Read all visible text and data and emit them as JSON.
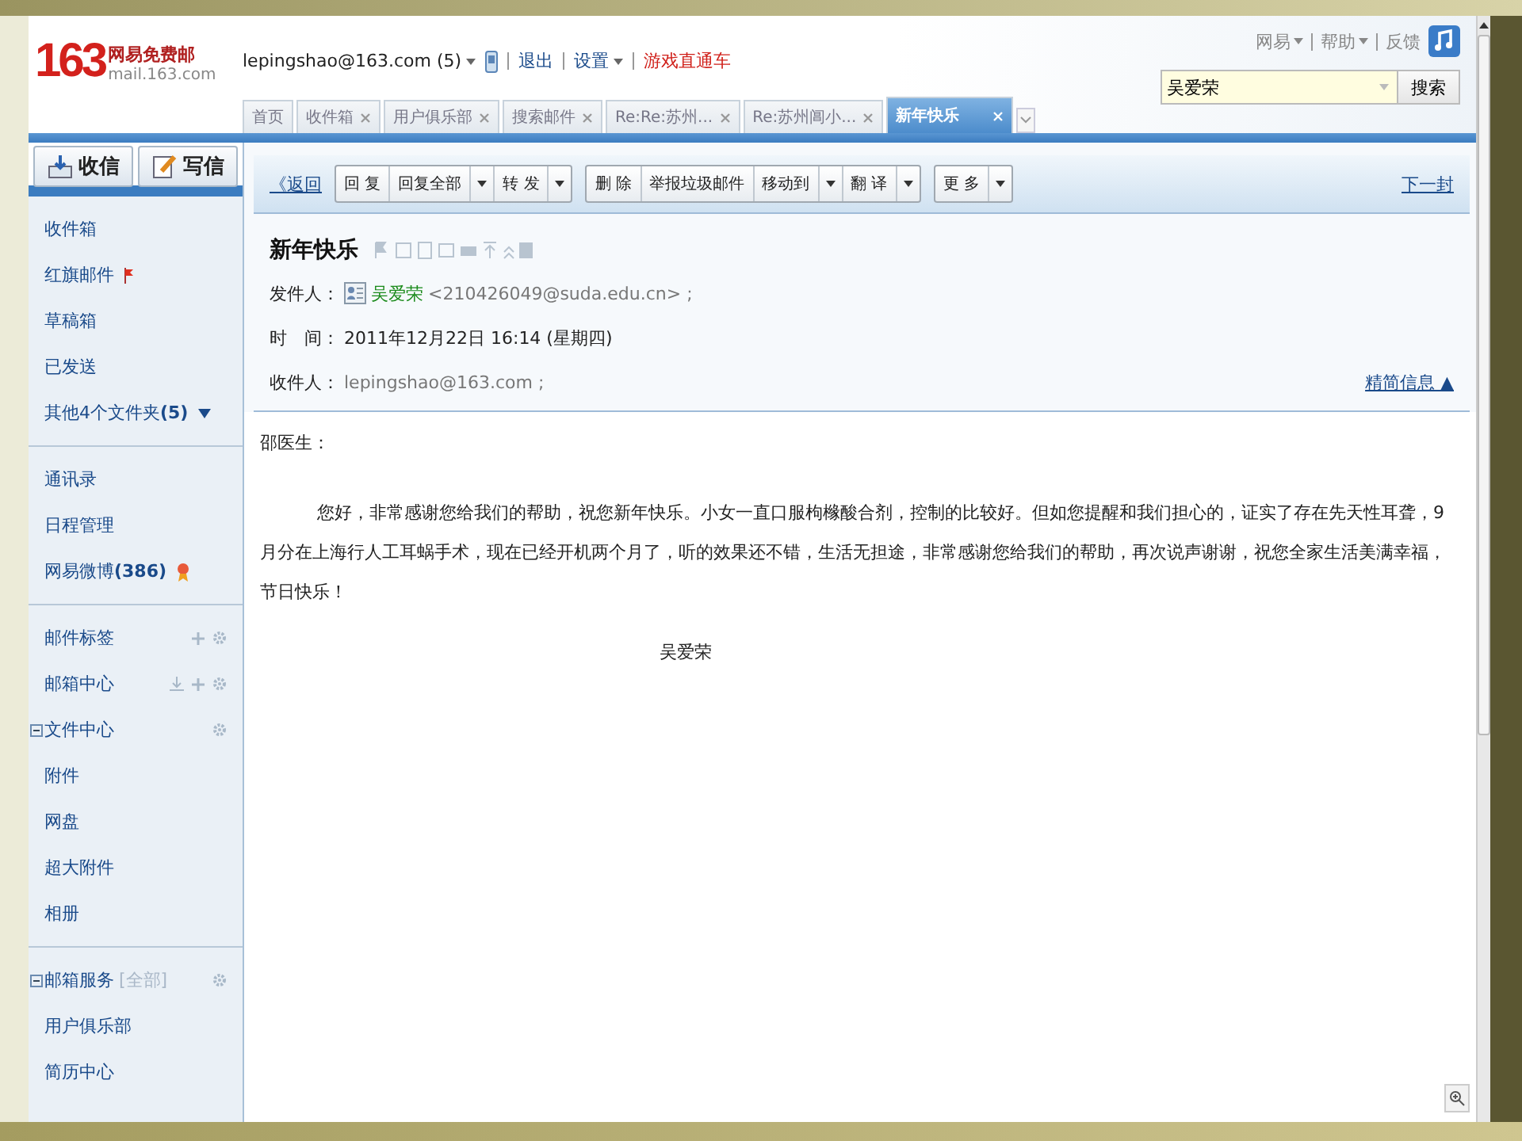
{
  "logo": {
    "number": "163",
    "name": "网易免费邮",
    "domain": "mail.163.com"
  },
  "account": {
    "label": "lepingshao@163.com (5)",
    "dropdown": true
  },
  "top_links": [
    {
      "label": "退出",
      "dropdown": false,
      "kind": "plain"
    },
    {
      "label": "设置",
      "dropdown": true,
      "kind": "plain"
    },
    {
      "label": "游戏直通车",
      "dropdown": false,
      "kind": "promo"
    }
  ],
  "right_links": [
    {
      "label": "网易",
      "dropdown": true
    },
    {
      "label": "帮助",
      "dropdown": true
    },
    {
      "label": "反馈",
      "dropdown": false
    }
  ],
  "tabs": [
    {
      "label": "首页",
      "closable": false,
      "selected": false
    },
    {
      "label": "收件箱",
      "closable": true,
      "selected": false
    },
    {
      "label": "用户俱乐部",
      "closable": true,
      "selected": false
    },
    {
      "label": "搜索邮件",
      "closable": true,
      "selected": false
    },
    {
      "label": "Re:Re:苏州...",
      "closable": true,
      "selected": false
    },
    {
      "label": "Re:苏州阊小...",
      "closable": true,
      "selected": false
    },
    {
      "label": "新年快乐",
      "closable": true,
      "selected": true
    }
  ],
  "search": {
    "value": "吴爱荣",
    "button": "搜索"
  },
  "actions": [
    {
      "label": "收信",
      "kind": "receive"
    },
    {
      "label": "写信",
      "kind": "compose"
    }
  ],
  "sidebar": {
    "sections": [
      {
        "items": [
          {
            "label": "收件箱",
            "kind": "plain"
          },
          {
            "label": "红旗邮件",
            "kind": "flag"
          },
          {
            "label": "草稿箱",
            "kind": "plain"
          },
          {
            "label": "已发送",
            "kind": "plain"
          },
          {
            "label": "其他4个文件夹",
            "count": "(5)",
            "kind": "more"
          }
        ]
      },
      {
        "items": [
          {
            "label": "通讯录",
            "kind": "plain"
          },
          {
            "label": "日程管理",
            "kind": "plain"
          },
          {
            "label": "网易微博",
            "count": "(386)",
            "kind": "badge"
          }
        ]
      },
      {
        "items": [
          {
            "label": "邮件标签",
            "kind": "tags"
          },
          {
            "label": "邮箱中心",
            "kind": "center"
          },
          {
            "label": "文件中心",
            "kind": "group",
            "expanded": true
          },
          {
            "label": "附件",
            "kind": "plain"
          },
          {
            "label": "网盘",
            "kind": "plain"
          },
          {
            "label": "超大附件",
            "kind": "plain"
          },
          {
            "label": "相册",
            "kind": "plain"
          }
        ]
      },
      {
        "items": [
          {
            "label": "邮箱服务",
            "extra": "[全部]",
            "kind": "group",
            "expanded": true
          },
          {
            "label": "用户俱乐部",
            "kind": "plain"
          },
          {
            "label": "简历中心",
            "kind": "plain"
          }
        ]
      }
    ]
  },
  "toolbar": {
    "back": "《返回",
    "groups": [
      [
        {
          "label": "回 复",
          "dropdown": false
        },
        {
          "label": "回复全部",
          "dropdown": true
        },
        {
          "label": "转 发",
          "dropdown": true
        }
      ],
      [
        {
          "label": "删 除",
          "dropdown": false
        },
        {
          "label": "举报垃圾邮件",
          "dropdown": false
        },
        {
          "label": "移动到",
          "dropdown": true
        },
        {
          "label": "翻 译",
          "dropdown": true
        }
      ],
      [
        {
          "label": "更 多",
          "dropdown": true
        }
      ]
    ],
    "next": "下一封"
  },
  "message": {
    "subject": "新年快乐",
    "fields": [
      {
        "kind": "sender",
        "label": "发件人：",
        "name": "吴爱荣",
        "value": "<210426049@suda.edu.cn> ;"
      },
      {
        "kind": "time",
        "label": "时　间：",
        "value": "2011年12月22日 16:14 (星期四)"
      },
      {
        "kind": "recipient",
        "label": "收件人：",
        "value": "lepingshao@163.com ;"
      }
    ],
    "toggle": "精简信息 ▲",
    "greeting": "邵医生：",
    "paragraph": "您好，非常感谢您给我们的帮助，祝您新年快乐。小女一直口服枸橼酸合剂，控制的比较好。但如您提醒和我们担心的，证实了存在先天性耳聋，9月分在上海行人工耳蜗手术，现在已经开机两个月了，听的效果还不错，生活无担途，非常感谢您给我们的帮助，再次说声谢谢，祝您全家生活美满幸福，节日快乐！",
    "signature": "吴爱荣"
  }
}
